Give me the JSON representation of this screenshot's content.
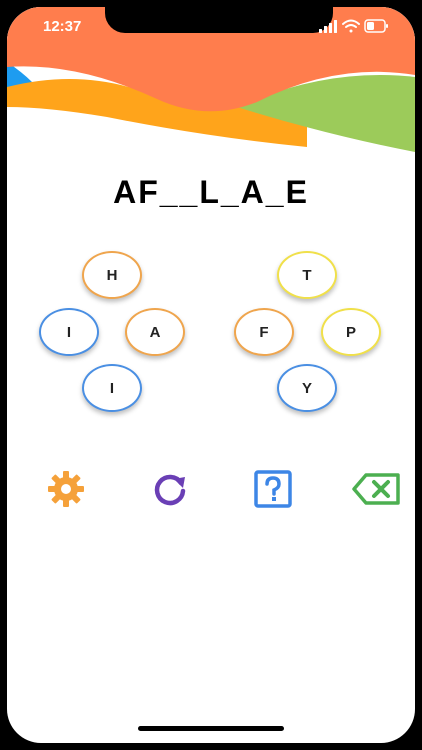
{
  "status": {
    "time": "12:37"
  },
  "puzzle": {
    "pattern": "AF__L_A_E"
  },
  "left_cluster": [
    {
      "letter": "H",
      "color": "#efa54d"
    },
    {
      "letter": "I",
      "color": "#4a8fe3"
    },
    {
      "letter": "A",
      "color": "#efa54d"
    },
    {
      "letter": "I",
      "color": "#4a8fe3"
    }
  ],
  "right_cluster": [
    {
      "letter": "T",
      "color": "#f0e04a"
    },
    {
      "letter": "F",
      "color": "#efa54d"
    },
    {
      "letter": "P",
      "color": "#f0e04a"
    },
    {
      "letter": "Y",
      "color": "#4a8fe3"
    }
  ],
  "toolbar": {
    "settings": {
      "icon": "gear-icon",
      "color": "#f5a13a"
    },
    "refresh": {
      "icon": "refresh-icon",
      "color": "#6a3fb5"
    },
    "hint": {
      "icon": "question-icon",
      "color": "#3d86e6"
    },
    "delete": {
      "icon": "backspace-icon",
      "color": "#4caf50"
    }
  },
  "colors": {
    "wave_orange": "#ff7d4d",
    "wave_gold": "#ffa41b",
    "wave_green": "#9ccb5a",
    "wave_blue": "#1e9cf0"
  }
}
